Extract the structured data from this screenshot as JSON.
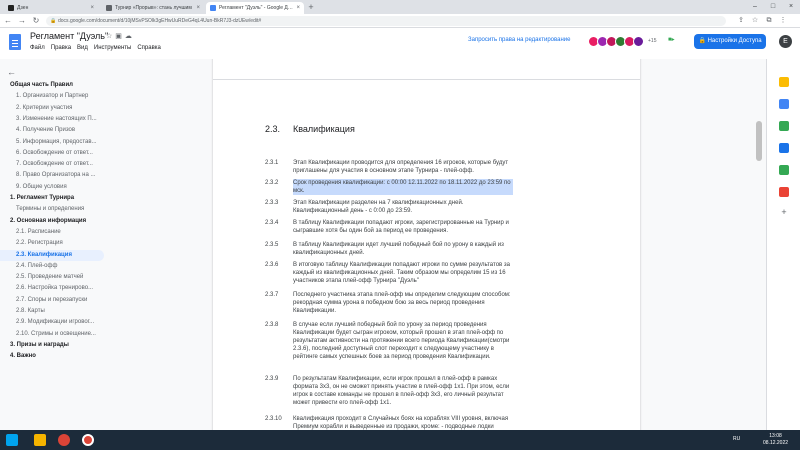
{
  "browser": {
    "tabs": [
      {
        "label": "Дзен",
        "active": false,
        "color": "#222222"
      },
      {
        "label": "Турнир «Прорыв»: стань лучшим",
        "active": false,
        "color": "#5f6368"
      },
      {
        "label": "Регламент \"Дуэль\" - Google До...",
        "active": true,
        "color": "#4285f4"
      }
    ],
    "url": "docs.google.com/document/d/10jMSvPSOlk3gEHwUuRDeG4qL4Uun-BkR7J3-dzUEw/edit#"
  },
  "docs": {
    "title": "Регламент \"Дуэль\"",
    "menu": [
      "Файл",
      "Правка",
      "Вид",
      "Инструменты",
      "Справка"
    ],
    "request_edit": "Запросить права на редактирование",
    "collaborators_more": "+15",
    "share_label": "Настройки Доступа",
    "user_initial": "E"
  },
  "outline": {
    "items": [
      {
        "label": "Общая часть Правил",
        "level": 1,
        "selected": false
      },
      {
        "label": "1. Организатор и Партнер",
        "level": 2,
        "selected": false
      },
      {
        "label": "2. Критерии участия",
        "level": 2,
        "selected": false
      },
      {
        "label": "3. Изменение настоящих П...",
        "level": 2,
        "selected": false
      },
      {
        "label": "4. Получение Призов",
        "level": 2,
        "selected": false
      },
      {
        "label": "5. Информация, предостав...",
        "level": 2,
        "selected": false
      },
      {
        "label": "6. Освобождение от ответ...",
        "level": 2,
        "selected": false
      },
      {
        "label": "7. Освобождение от ответ...",
        "level": 2,
        "selected": false
      },
      {
        "label": "8. Право Организатора на ...",
        "level": 2,
        "selected": false
      },
      {
        "label": "9. Общие условия",
        "level": 2,
        "selected": false
      },
      {
        "label": "1. Регламент Турнира",
        "level": 1,
        "selected": false
      },
      {
        "label": "Термины и определения",
        "level": 2,
        "selected": false
      },
      {
        "label": "2. Основная информация",
        "level": 1,
        "selected": false
      },
      {
        "label": "2.1. Расписание",
        "level": 2,
        "selected": false
      },
      {
        "label": "2.2. Регистрация",
        "level": 2,
        "selected": false
      },
      {
        "label": "2.3. Квалификация",
        "level": 2,
        "selected": true
      },
      {
        "label": "2.4. Плей-офф",
        "level": 2,
        "selected": false
      },
      {
        "label": "2.5. Проведение матчей",
        "level": 2,
        "selected": false
      },
      {
        "label": "2.6. Настройка тренирово...",
        "level": 2,
        "selected": false
      },
      {
        "label": "2.7. Споры и перезапуски",
        "level": 2,
        "selected": false
      },
      {
        "label": "2.8. Карты",
        "level": 2,
        "selected": false
      },
      {
        "label": "2.9. Модификации игровог...",
        "level": 2,
        "selected": false
      },
      {
        "label": "2.10. Стримы и освещение...",
        "level": 2,
        "selected": false
      },
      {
        "label": "3. Призы и награды",
        "level": 1,
        "selected": false
      },
      {
        "label": "4. Важно",
        "level": 1,
        "selected": false
      }
    ]
  },
  "document": {
    "section_number": "2.3.",
    "section_title": "Квалификация",
    "paragraphs": [
      {
        "num": "2.3.1",
        "text": "Этап Квалификации  проводится для определения 16 игроков, которые будут приглашены для участия в основном этапе Турнира - плей-офф.",
        "highlight": false
      },
      {
        "num": "2.3.2",
        "text": "Срок проведения квалификации: с 00:00 12.11.2022 по 18.11.2022 до 23:59 по мск.",
        "highlight": true
      },
      {
        "num": "2.3.3",
        "text": "Этап Квалификации разделен на 7 квалификационных дней. Квалификационный день - с 0:00 до 23:59.",
        "highlight": false
      },
      {
        "num": "2.3.4",
        "text": "В таблицу Квалификации попадают игроки, зарегистрированные на Турнир и сыгравшие хотя бы один бой за период ее проведения.",
        "highlight": false
      },
      {
        "num": "2.3.5",
        "text": "В таблицу Квалификации идет лучший победный бой по урону в каждый из квалификационных дней.",
        "highlight": false
      },
      {
        "num": "2.3.6",
        "text": "В итоговую таблицу Квалификации попадают игроки по сумме результатов за каждый из квалификационных дней. Таким образом мы определим 15 из 16 участников этапа плей-офф Турнира \"Дуэль\"",
        "highlight": false
      },
      {
        "num": "2.3.7",
        "text": "Последнего участника этапа плей-офф мы определим следующим способом: рекордная сумма урона в победном бою за весь период проведения Квалификации.",
        "highlight": false
      },
      {
        "num": "2.3.8",
        "text": "В случае если лучший победный бой по урону за период проведения Квалификации будет сыгран игроком, который прошел в этап плей-офф по результатам активности на протяжении всего периода Квалификации(смотри 2.3.6), последний доступный слот переходит к следующему участнику в рейтинге самых успешных боев за период проведения Квалификации.",
        "highlight": false
      },
      {
        "num": "2.3.9",
        "text": "По результатам Квалификации, если игрок прошел в плей-офф в рамках формата 3х3, он не сможет принять участие в плей-офф 1х1. При этом, если игрок в составе команды не прошел в плей-офф 3х3, его личный результат может привести его плей-офф 1х1.",
        "highlight": false
      },
      {
        "num": "2.3.10",
        "text": " Квалификация проходит в Случайных боях на кораблях VIII уровня, включая Премиум корабли и выведенные из продажи, кроме: - подводные лодки",
        "highlight": false
      }
    ]
  },
  "taskbar": {
    "lang": "RU",
    "time": "13:08",
    "date": "08.12.2022"
  }
}
